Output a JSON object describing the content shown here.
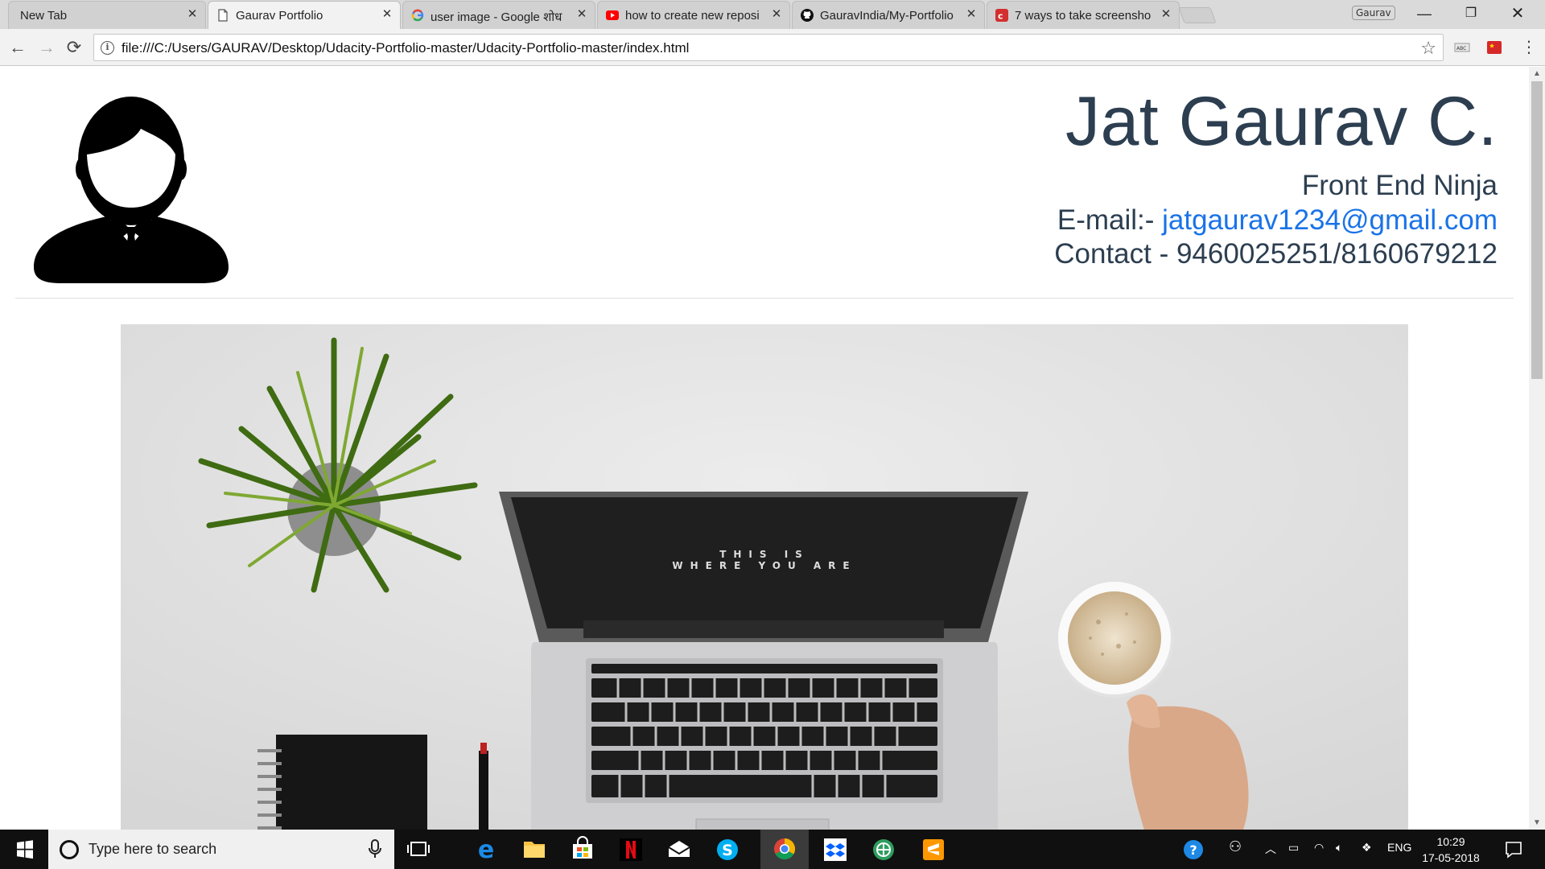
{
  "browser": {
    "tabs": [
      {
        "title": "New Tab",
        "favicon": "none"
      },
      {
        "title": "Gaurav Portfolio",
        "favicon": "page-icon",
        "active": true
      },
      {
        "title": "user image - Google शोध",
        "favicon": "google-icon"
      },
      {
        "title": "how to create new reposi",
        "favicon": "youtube-icon"
      },
      {
        "title": "GauravIndia/My-Portfolio",
        "favicon": "github-icon"
      },
      {
        "title": "7 ways to take screensho",
        "favicon": "red-c-icon"
      }
    ],
    "profile_name": "Gaurav",
    "url": "file:///C:/Users/GAURAV/Desktop/Udacity-Portfolio-master/Udacity-Portfolio-master/index.html",
    "colors": {
      "tabstrip": "#dadada",
      "toolbar": "#f2f2f2"
    }
  },
  "page": {
    "name": "Jat Gaurav C.",
    "role": "Front End Ninja",
    "email_label": "E-mail:- ",
    "email": "jatgaurav1234@gmail.com",
    "contact": "Contact - 9460025251/8160679212",
    "hero_screen_text_line1": "THIS IS",
    "hero_screen_text_line2": "WHERE YOU ARE",
    "colors": {
      "heading": "#2c3e50",
      "link": "#1a73e8"
    }
  },
  "taskbar": {
    "search_placeholder": "Type here to search",
    "apps": [
      "task-view",
      "edge",
      "file-explorer",
      "store",
      "netflix",
      "mail",
      "skype",
      "chrome",
      "dropbox",
      "app",
      "sublime-text"
    ],
    "tray_language": "ENG",
    "time": "10:29",
    "date": "17-05-2018"
  }
}
